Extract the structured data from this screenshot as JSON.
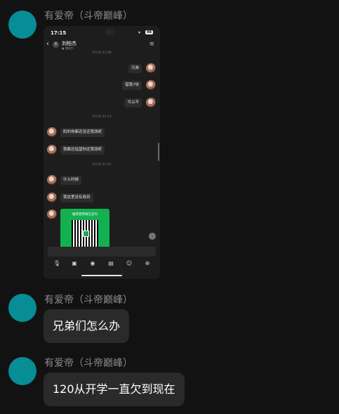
{
  "colors": {
    "background": "#121212",
    "avatar": "#078d96",
    "bubble": "#2a2a2a",
    "sender": "#8a8a8a",
    "pay_card": "#13b050"
  },
  "messages": [
    {
      "sender": "有爱帝（斗帝巅峰）"
    },
    {
      "sender": "有爱帝（斗帝巅峰）",
      "text": "兄弟们怎么办"
    },
    {
      "sender": "有爱帝（斗帝巅峰）",
      "text": "120从开学一直欠到现在"
    }
  ],
  "phone": {
    "status": {
      "time": "17:15",
      "signal": "▾",
      "battery": "98"
    },
    "header": {
      "back": "‹",
      "badge": "8",
      "contact": "刘柏杰",
      "subtitle": "● 播放中",
      "menu": "≡"
    },
    "chat": {
      "ts1": "07/10 21:08",
      "out1": "兄弟",
      "out2": "借我7块",
      "out3": "可以不",
      "ts2": "07/10 21:53",
      "in1": "妈的你都还没还我钱呢",
      "in2": "我都还指望你还我钱呢",
      "ts3": "07/10 21:55",
      "in3": "什么时候",
      "in4": "我这里没有收到",
      "pay_title": "推荐使用微信支付"
    },
    "toolbar": {
      "mic": "🎙",
      "image": "▣",
      "camera": "◉",
      "card": "▤",
      "emoji": "☺",
      "plus": "⊕"
    }
  }
}
